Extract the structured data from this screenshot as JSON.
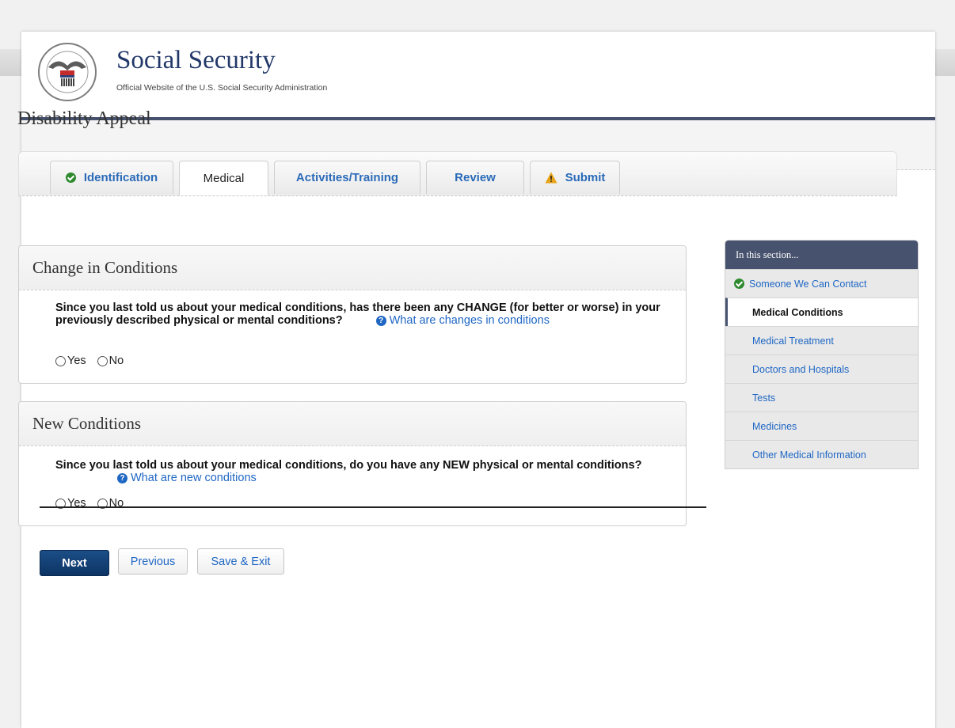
{
  "brand": {
    "title": "Social Security",
    "subtitle": "Official Website of the U.S. Social Security Administration"
  },
  "page": {
    "title": "Disability Appeal"
  },
  "tabs": [
    {
      "label": "Identification",
      "status": "complete"
    },
    {
      "label": "Medical",
      "status": "current"
    },
    {
      "label": "Activities/Training",
      "status": ""
    },
    {
      "label": "Review",
      "status": ""
    },
    {
      "label": "Submit",
      "status": "warning"
    }
  ],
  "sections": [
    {
      "title": "Change in Conditions",
      "question": "Since you last told us about your medical conditions, has there been any CHANGE (for better or worse) in your previously described physical or mental conditions?",
      "help": "What are changes in conditions",
      "options": [
        "Yes",
        "No"
      ]
    },
    {
      "title": "New Conditions",
      "question": "Since you last told us about your medical conditions, do you have any NEW physical or mental conditions?",
      "help": "What are new conditions",
      "options": [
        "Yes",
        "No"
      ]
    }
  ],
  "buttons": {
    "next": "Next",
    "previous": "Previous",
    "save_exit": "Save & Exit"
  },
  "sidenav": {
    "heading": "In this section...",
    "items": [
      "Someone We Can Contact",
      "Medical Conditions",
      "Medical Treatment",
      "Doctors and Hospitals",
      "Tests",
      "Medicines",
      "Other Medical Information"
    ],
    "current_index": 1
  },
  "colors": {
    "brand_navy": "#223869",
    "link_blue": "#1f67c4",
    "complete_green": "#2d8a2d",
    "warning_amber": "#e8a317",
    "nav_header": "#47526e"
  }
}
